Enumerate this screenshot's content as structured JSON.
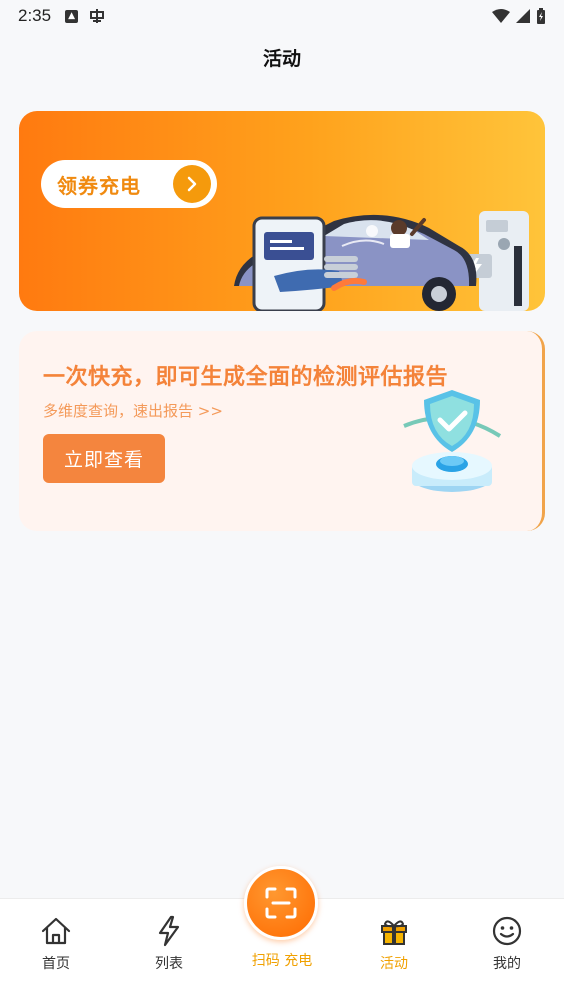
{
  "status_bar": {
    "time": "2:35"
  },
  "header": {
    "title": "活动"
  },
  "coupon_banner": {
    "label": "领券充电"
  },
  "report_card": {
    "title": "一次快充，即可生成全面的检测评估报告",
    "subtitle": "多维度查询，速出报告 >>",
    "button_label": "立即查看"
  },
  "tab_bar": {
    "home": "首页",
    "list": "列表",
    "scan": "扫码 充电",
    "activity": "活动",
    "mine": "我的",
    "active_color": "#f0a000"
  }
}
